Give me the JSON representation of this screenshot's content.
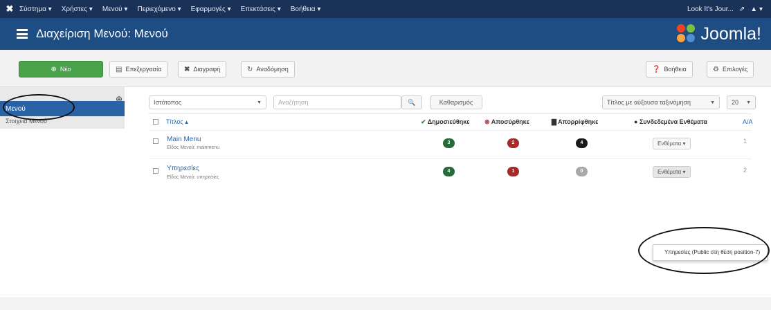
{
  "topbar": {
    "logo_icon": "joomla-icon",
    "menus": [
      "Σύστημα ▾",
      "Χρήστες ▾",
      "Μενού ▾",
      "Περιεχόμενο ▾",
      "Εφαρμογές ▾",
      "Επεκτάσεις ▾",
      "Βοήθεια ▾"
    ],
    "site_link": "Look It's Jour...",
    "user_icon": "user-icon"
  },
  "header": {
    "title": "Διαχείριση Μενού: Μενού",
    "logo_text": "Joomla!"
  },
  "toolbar": {
    "new_label": "Νέο",
    "edit_label": "Επεξεργασία",
    "delete_label": "Διαγραφή",
    "rebuild_label": "Αναδόμηση",
    "help_label": "Βοήθεια",
    "options_label": "Επιλογές"
  },
  "sidebar": {
    "items": [
      {
        "label": "Μενού",
        "active": true
      },
      {
        "label": "Στοιχεία Μενού",
        "active": false
      }
    ]
  },
  "filters": {
    "site_select": "Ιστότοπος",
    "search_placeholder": "Αναζήτηση",
    "clear_label": "Καθαρισμός",
    "sort_select": "Τίτλος με αύξουσα ταξινόμηση",
    "limit_select": "20"
  },
  "table": {
    "headers": {
      "title": "Τίτλος ▴",
      "published": "Δημοσιεύθηκε",
      "unpublished": "Αποσύρθηκε",
      "trashed": "Απορρίφθηκε",
      "linked_modules": "Συνδεδεμένα Ενθέματα",
      "id": "Α/Α"
    },
    "rows": [
      {
        "title": "Main Menu",
        "type": "Είδος Μενού: mainmenu",
        "published": "3",
        "unpublished": "2",
        "trashed": "4",
        "module_btn": "Ενθέματα ▾",
        "id": "1"
      },
      {
        "title": "Υπηρεσίες",
        "type": "Είδος Μενού: υπηρεσίες",
        "published": "4",
        "unpublished": "1",
        "trashed": "0",
        "module_btn": "Ενθέματα ▾",
        "id": "2"
      }
    ]
  },
  "dropdown": {
    "item": "Υπηρεσίες (Public στη θέση position-7)"
  },
  "colors": {
    "topbar": "#1a3158",
    "header": "#1e4d84",
    "new_button": "#4aa24a",
    "sidebar_active": "#2a62a6",
    "published_badge": "#2a6a3a",
    "unpublished_badge": "#a62a2a",
    "trashed_badge": "#1a1a1a",
    "trashed_zero_badge": "#a9a9a9"
  }
}
